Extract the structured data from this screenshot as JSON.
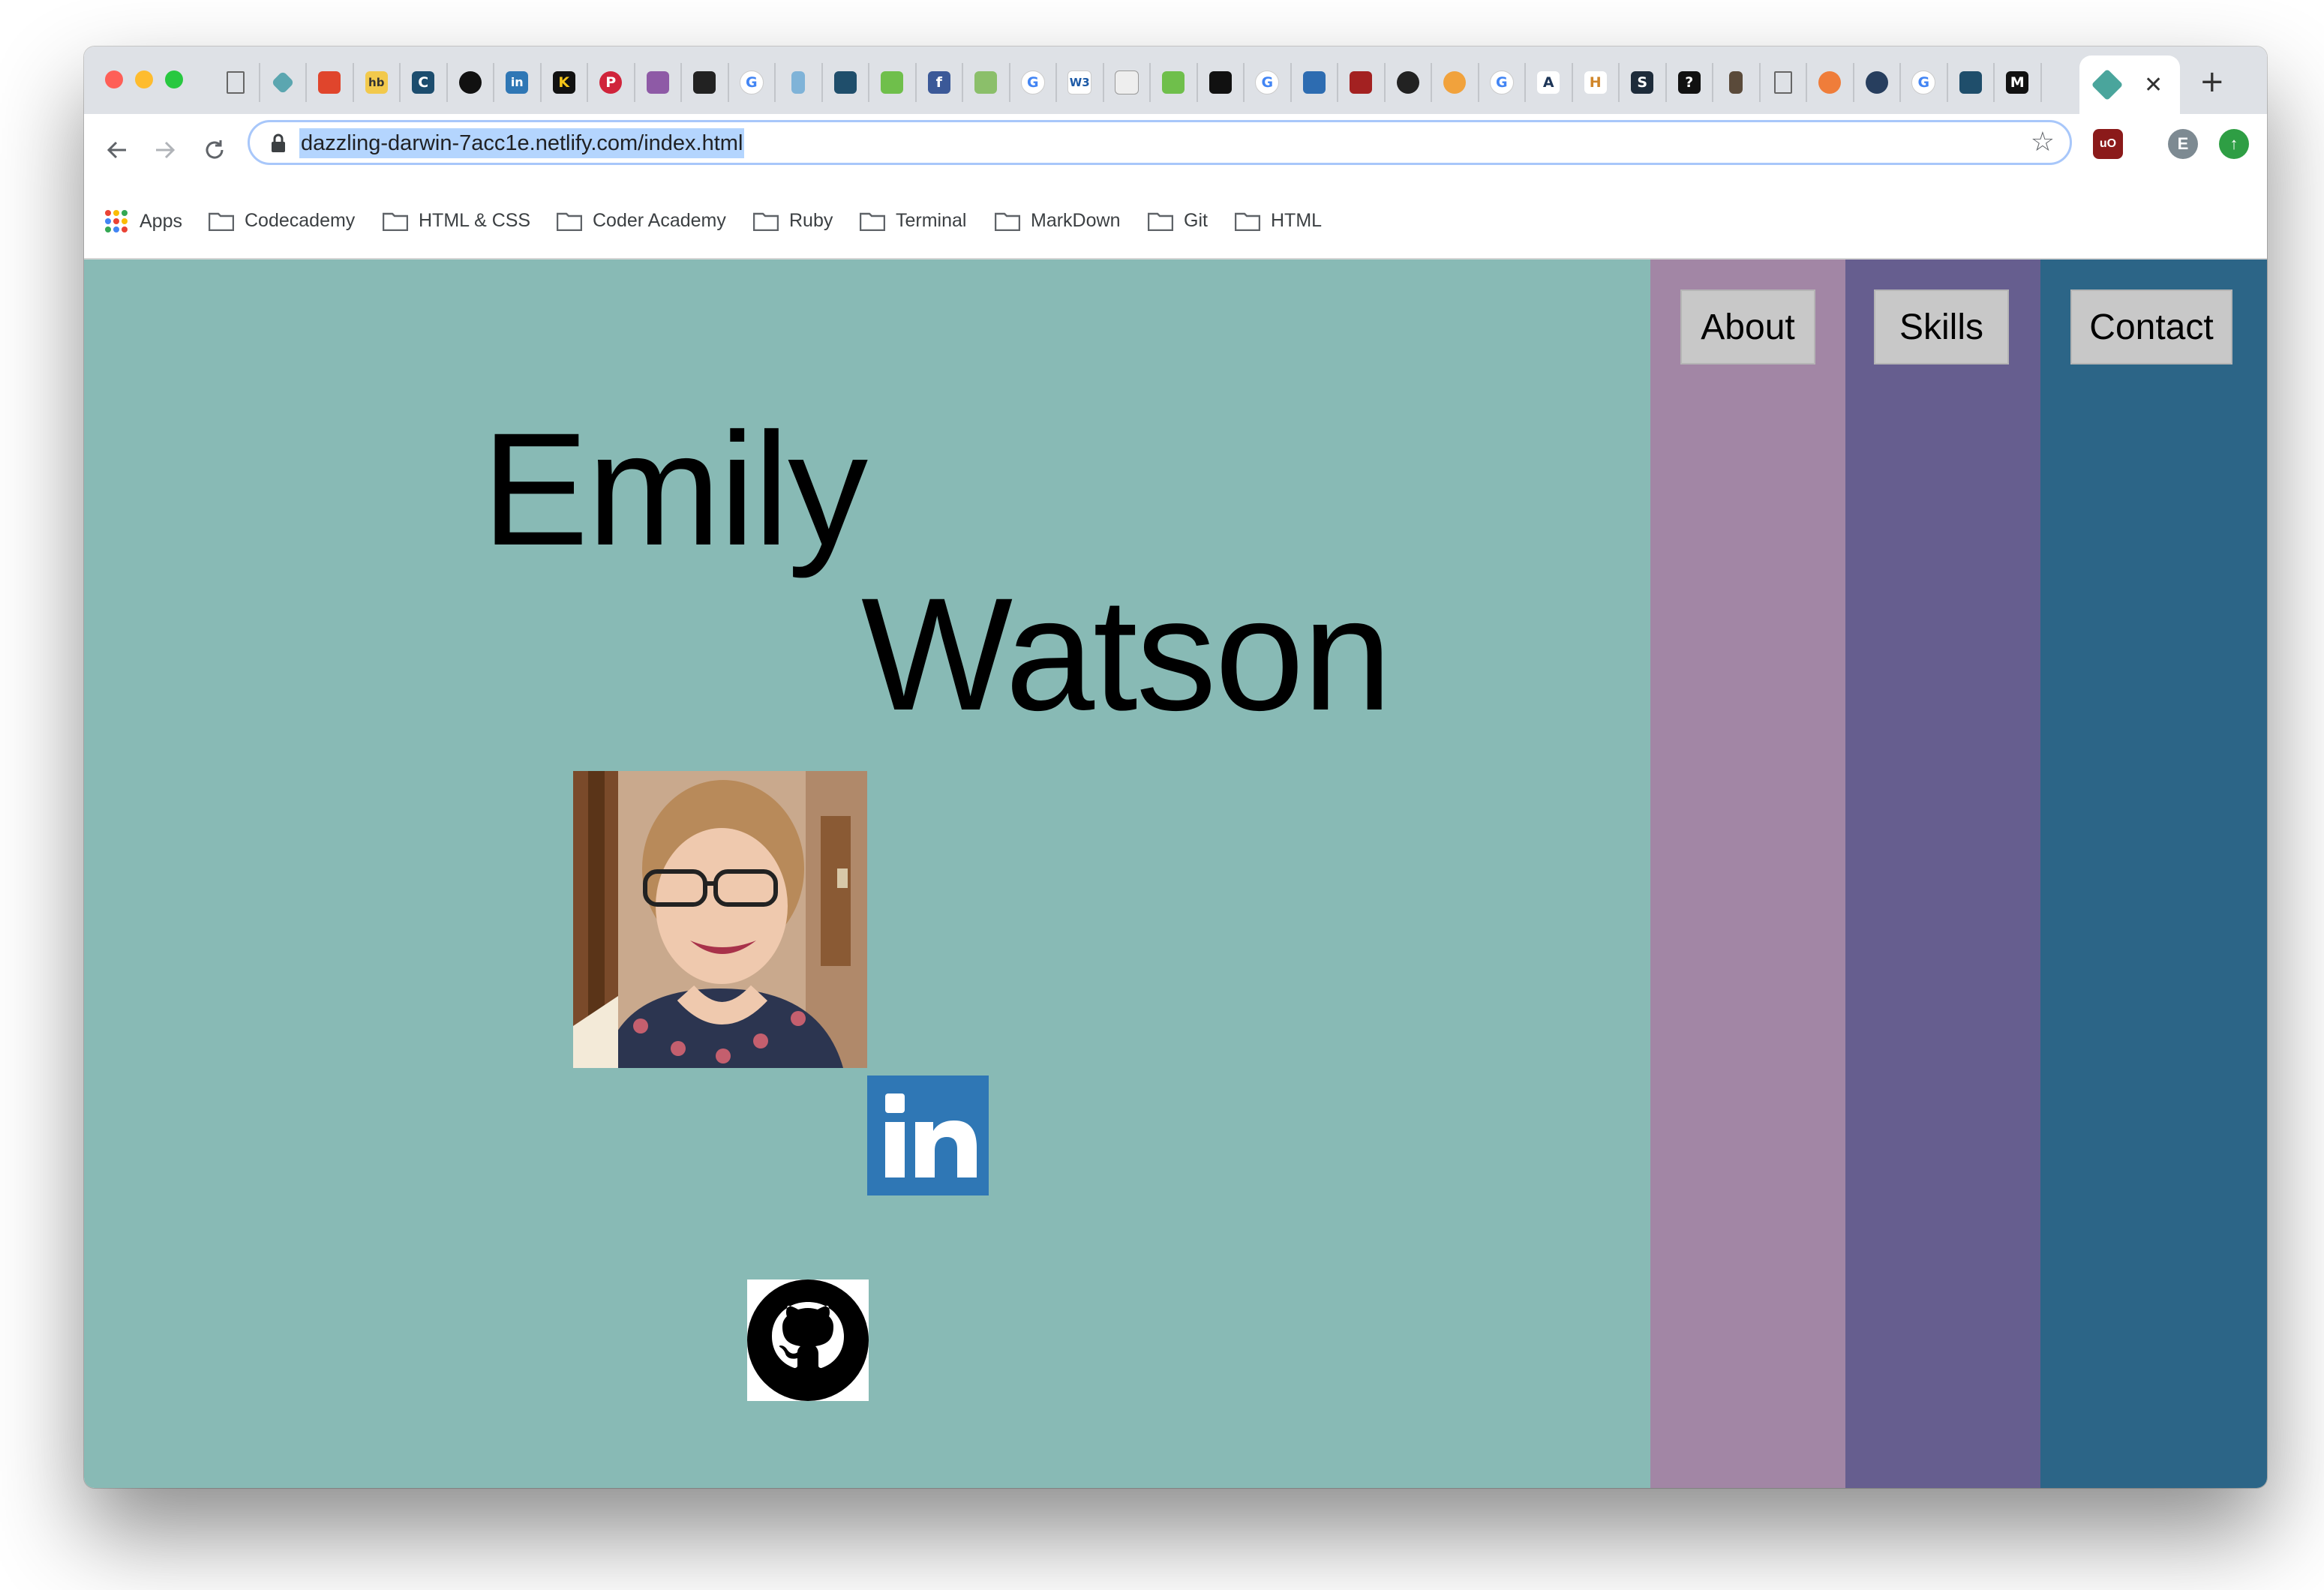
{
  "browser": {
    "url": "dazzling-darwin-7acc1e.netlify.com/index.html",
    "active_tab_close": "✕",
    "new_tab": "+",
    "profile_initial": "E",
    "bookmarks": [
      {
        "label": "Apps"
      },
      {
        "label": "Codecademy"
      },
      {
        "label": "HTML & CSS"
      },
      {
        "label": "Coder Academy"
      },
      {
        "label": "Ruby"
      },
      {
        "label": "Terminal"
      },
      {
        "label": "MarkDown"
      },
      {
        "label": "Git"
      },
      {
        "label": "HTML"
      }
    ]
  },
  "site": {
    "first_name": "Emily",
    "last_name": "Watson",
    "nav": {
      "about": "About",
      "skills": "Skills",
      "contact": "Contact"
    },
    "linkedin_text": "in",
    "colors": {
      "background": "#88bab5",
      "about_column": "#a286a5",
      "skills_column": "#665e8f",
      "contact_column": "#2c6587",
      "linkedin": "#2f77b5"
    }
  }
}
